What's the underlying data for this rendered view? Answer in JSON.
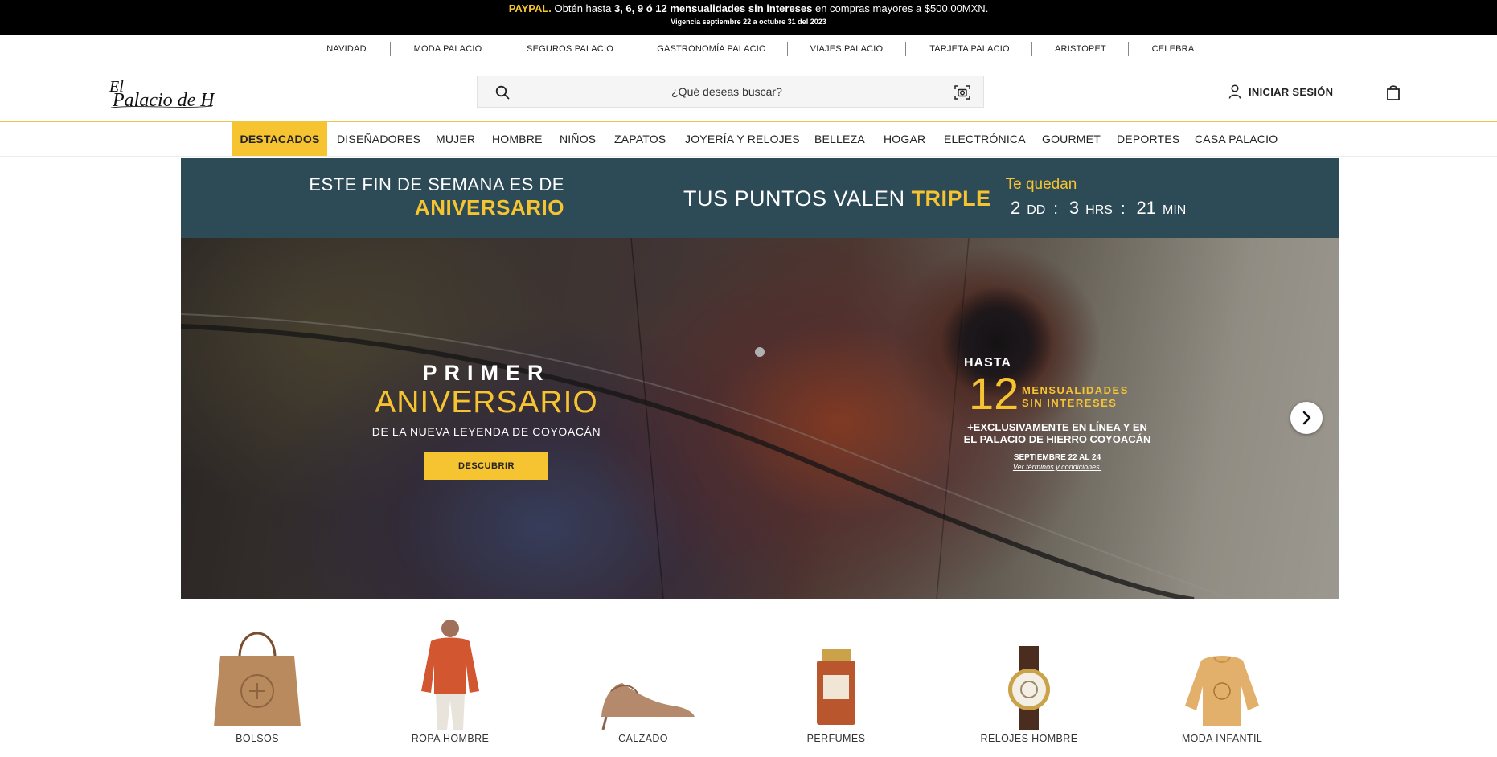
{
  "promo": {
    "brand": "PAYPAL.",
    "text_a": " Obtén hasta ",
    "bold_a": "3, 6, 9 ó 12 mensualidades sin intereses",
    "text_b": " en compras mayores a $500.00MXN.",
    "validity": "Vigencia septiembre 22 a octubre 31 del 2023"
  },
  "subsidiaries": [
    "NAVIDAD",
    "MODA PALACIO",
    "SEGUROS PALACIO",
    "GASTRONOMÍA PALACIO",
    "VIAJES PALACIO",
    "TARJETA PALACIO",
    "ARISTOPET",
    "CELEBRA"
  ],
  "header": {
    "logo_text": "El Palacio de Hierro",
    "search_placeholder": "¿Qué deseas buscar?",
    "login_label": "INICIAR SESIÓN"
  },
  "categories": [
    "DESTACADOS",
    "DISEÑADORES",
    "MUJER",
    "HOMBRE",
    "NIÑOS",
    "ZAPATOS",
    "JOYERÍA Y RELOJES",
    "BELLEZA",
    "HOGAR",
    "ELECTRÓNICA",
    "GOURMET",
    "DEPORTES",
    "CASA PALACIO"
  ],
  "countdown": {
    "line1": "ESTE FIN DE SEMANA ES DE",
    "line2": "ANIVERSARIO",
    "mid_text": "TUS PUNTOS VALEN ",
    "mid_highlight": "TRIPLE",
    "te_quedan": "Te quedan",
    "days": "2",
    "days_unit": "DD",
    "hours": "3",
    "hours_unit": "HRS",
    "minutes": "21",
    "minutes_unit": "MIN",
    "sep": ":"
  },
  "hero": {
    "primer": "PRIMER",
    "aniversario": "ANIVERSARIO",
    "subtitle": "DE LA NUEVA LEYENDA DE COYOACÁN",
    "cta": "DESCUBRIR",
    "hasta": "HASTA",
    "big_number": "12",
    "mensualidades": "MENSUALIDADES",
    "sin_intereses": "SIN INTERESES",
    "exclusive_1": "+EXCLUSIVAMENTE EN LÍNEA Y EN",
    "exclusive_2": "EL PALACIO DE HIERRO COYOACÁN",
    "dates": "SEPTIEMBRE 22 AL 24",
    "terms": "Ver términos y condiciones."
  },
  "tiles": [
    "BOLSOS",
    "ROPA HOMBRE",
    "CALZADO",
    "PERFUMES",
    "RELOJES HOMBRE",
    "MODA INFANTIL"
  ],
  "colors": {
    "accent": "#f6c431",
    "banner": "#2d4a57",
    "promo_bg": "#000000"
  }
}
